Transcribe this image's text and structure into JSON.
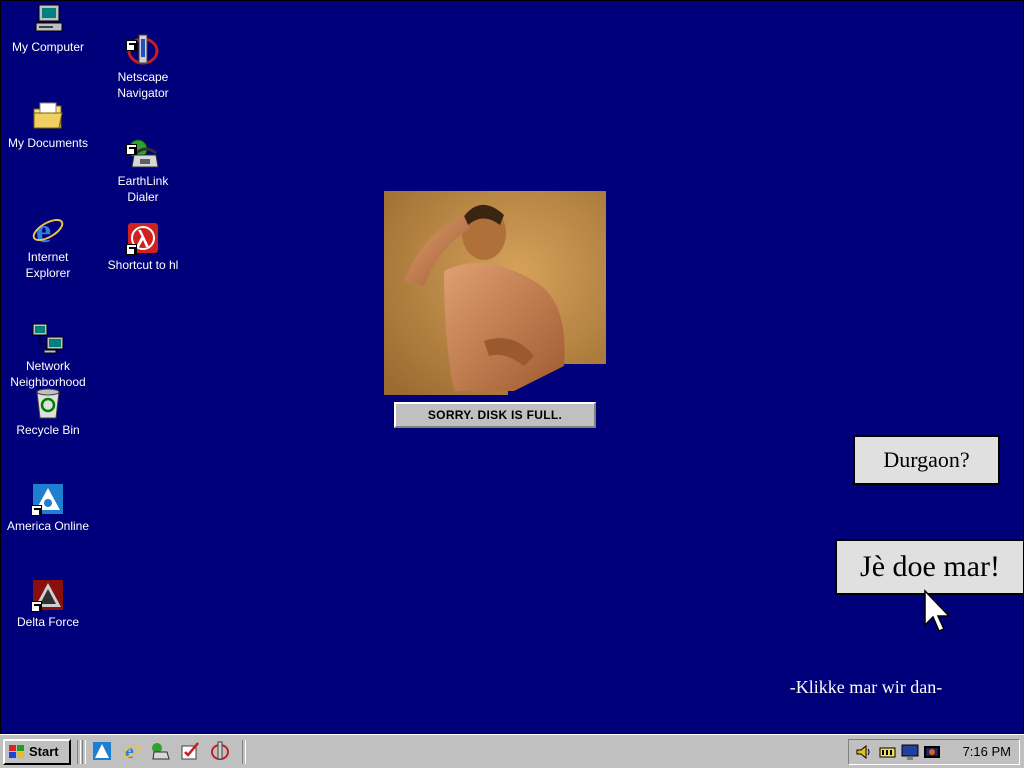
{
  "desktop": {
    "icons_col1": [
      {
        "label": "My Computer",
        "icon": "computer-icon"
      },
      {
        "label": "My Documents",
        "icon": "folder-icon"
      },
      {
        "label": "Internet\nExplorer",
        "icon": "ie-icon"
      },
      {
        "label": "Network\nNeighborhood",
        "icon": "network-icon"
      },
      {
        "label": "Recycle Bin",
        "icon": "recycle-bin-icon"
      },
      {
        "label": "America Online",
        "icon": "aol-icon"
      },
      {
        "label": "Delta Force",
        "icon": "delta-force-icon"
      }
    ],
    "icons_col2": [
      {
        "label": "Netscape\nNavigator",
        "icon": "netscape-icon"
      },
      {
        "label": "EarthLink\nDialer",
        "icon": "phone-icon"
      },
      {
        "label": "Shortcut to hl",
        "icon": "half-life-icon"
      }
    ]
  },
  "popup": {
    "message": "SORRY. DISK IS FULL."
  },
  "callouts": {
    "question": "Durgaon?",
    "answer": "Jè doe mar!"
  },
  "hint": "-Klikke mar wir dan-",
  "taskbar": {
    "start_label": "Start",
    "quick_launch": [
      "aol-icon",
      "ie-icon",
      "phone-icon",
      "check-icon",
      "netscape-icon"
    ],
    "tray_icons": [
      "speaker-icon",
      "battery-icon",
      "monitor-icon",
      "display-icon"
    ],
    "clock": "7:16 PM"
  },
  "colors": {
    "desktop": "#00007a",
    "taskbar": "#c0c0c0"
  }
}
